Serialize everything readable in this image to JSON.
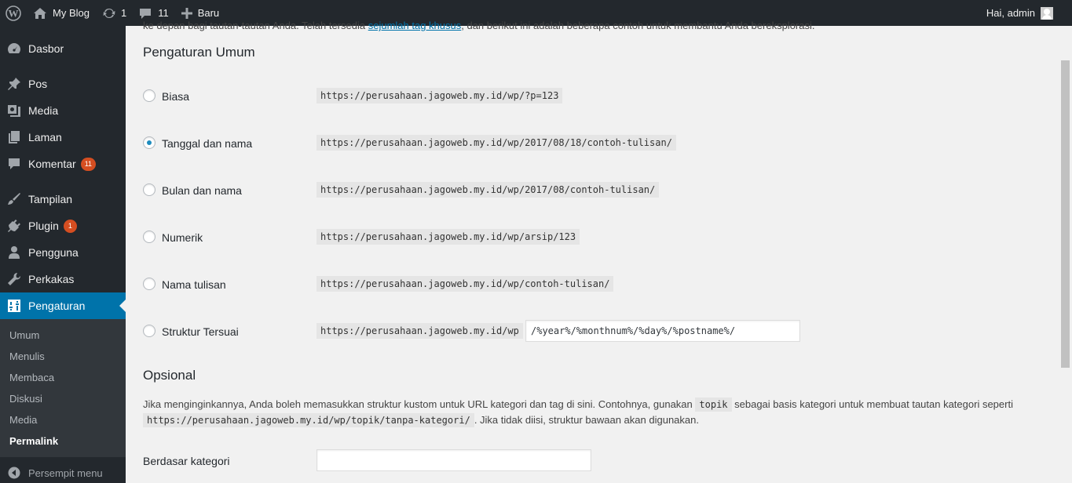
{
  "adminbar": {
    "site_name": "My Blog",
    "updates_count": "1",
    "comments_count": "11",
    "new_label": "Baru",
    "greeting": "Hai, admin"
  },
  "sidebar": {
    "items": [
      {
        "label": "Dasbor",
        "icon": "dashboard-icon"
      },
      {
        "label": "Pos",
        "icon": "pin-icon"
      },
      {
        "label": "Media",
        "icon": "media-icon"
      },
      {
        "label": "Laman",
        "icon": "page-icon"
      },
      {
        "label": "Komentar",
        "icon": "comment-icon",
        "badge": "11"
      },
      {
        "label": "Tampilan",
        "icon": "brush-icon"
      },
      {
        "label": "Plugin",
        "icon": "plugin-icon",
        "badge": "1"
      },
      {
        "label": "Pengguna",
        "icon": "user-icon"
      },
      {
        "label": "Perkakas",
        "icon": "wrench-icon"
      },
      {
        "label": "Pengaturan",
        "icon": "settings-icon"
      }
    ],
    "submenu": [
      "Umum",
      "Menulis",
      "Membaca",
      "Diskusi",
      "Media",
      "Permalink"
    ],
    "collapse_label": "Persempit menu"
  },
  "content": {
    "top_text_before": "ke depan bagi tautan-tautan Anda. Telah tersedia",
    "top_link": "sejumlah tag khusus",
    "top_text_after": ", dan berikut ini adalah beberapa contoh untuk membantu Anda bereksplorasi.",
    "general_heading": "Pengaturan Umum",
    "options": [
      {
        "label": "Biasa",
        "example": "https://perusahaan.jagoweb.my.id/wp/?p=123",
        "checked": false
      },
      {
        "label": "Tanggal dan nama",
        "example": "https://perusahaan.jagoweb.my.id/wp/2017/08/18/contoh-tulisan/",
        "checked": true
      },
      {
        "label": "Bulan dan nama",
        "example": "https://perusahaan.jagoweb.my.id/wp/2017/08/contoh-tulisan/",
        "checked": false
      },
      {
        "label": "Numerik",
        "example": "https://perusahaan.jagoweb.my.id/wp/arsip/123",
        "checked": false
      },
      {
        "label": "Nama tulisan",
        "example": "https://perusahaan.jagoweb.my.id/wp/contoh-tulisan/",
        "checked": false
      },
      {
        "label": "Struktur Tersuai",
        "example": "https://perusahaan.jagoweb.my.id/wp",
        "checked": false
      }
    ],
    "custom_structure_value": "/%year%/%monthnum%/%day%/%postname%/",
    "optional_heading": "Opsional",
    "optional_desc_1": "Jika menginginkannya, Anda boleh memasukkan struktur kustom untuk URL kategori dan tag di sini. Contohnya, gunakan",
    "optional_code_1": "topik",
    "optional_desc_2": "sebagai basis kategori untuk membuat tautan kategori seperti",
    "optional_code_2": "https://perusahaan.jagoweb.my.id/wp/topik/tanpa-kategori/",
    "optional_desc_3": ". Jika tidak diisi, struktur bawaan akan digunakan.",
    "category_base_label": "Berdasar kategori",
    "category_base_value": ""
  },
  "colors": {
    "adminbar_bg": "#23282d",
    "accent": "#0073aa",
    "badge": "#d54e21",
    "content_bg": "#f1f1f1"
  }
}
